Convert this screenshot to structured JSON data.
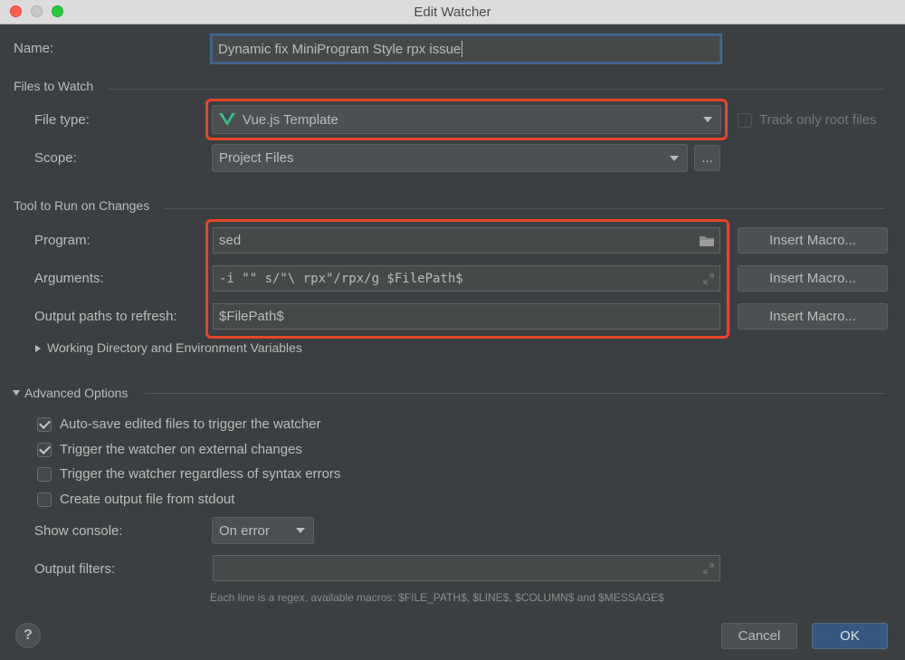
{
  "window": {
    "title": "Edit Watcher"
  },
  "name": {
    "label": "Name:",
    "value": "Dynamic fix MiniProgram Style rpx issue"
  },
  "files_to_watch": {
    "section_title": "Files to Watch",
    "file_type_label": "File type:",
    "file_type_value": "Vue.js Template",
    "file_type_icon": "vue-icon",
    "track_root_label": "Track only root files",
    "scope_label": "Scope:",
    "scope_value": "Project Files",
    "scope_browse": "..."
  },
  "tool": {
    "section_title": "Tool to Run on Changes",
    "program_label": "Program:",
    "program_value": "sed",
    "arguments_label": "Arguments:",
    "arguments_value": "-i \"\" s/\"\\ rpx\"/rpx/g $FilePath$",
    "output_label": "Output paths to refresh:",
    "output_value": "$FilePath$",
    "insert_macro": "Insert Macro...",
    "working_dir": "Working Directory and Environment Variables"
  },
  "advanced": {
    "section_title": "Advanced Options",
    "options": [
      {
        "label": "Auto-save edited files to trigger the watcher",
        "checked": true
      },
      {
        "label": "Trigger the watcher on external changes",
        "checked": true
      },
      {
        "label": "Trigger the watcher regardless of syntax errors",
        "checked": false
      },
      {
        "label": "Create output file from stdout",
        "checked": false
      }
    ],
    "show_console_label": "Show console:",
    "show_console_value": "On error",
    "output_filters_label": "Output filters:",
    "hint": "Each line is a regex, available macros: $FILE_PATH$, $LINE$, $COLUMN$ and $MESSAGE$"
  },
  "footer": {
    "help": "?",
    "cancel": "Cancel",
    "ok": "OK"
  },
  "colors": {
    "highlight": "#e8452c",
    "vue_green": "#41b883",
    "primary": "#365880"
  }
}
